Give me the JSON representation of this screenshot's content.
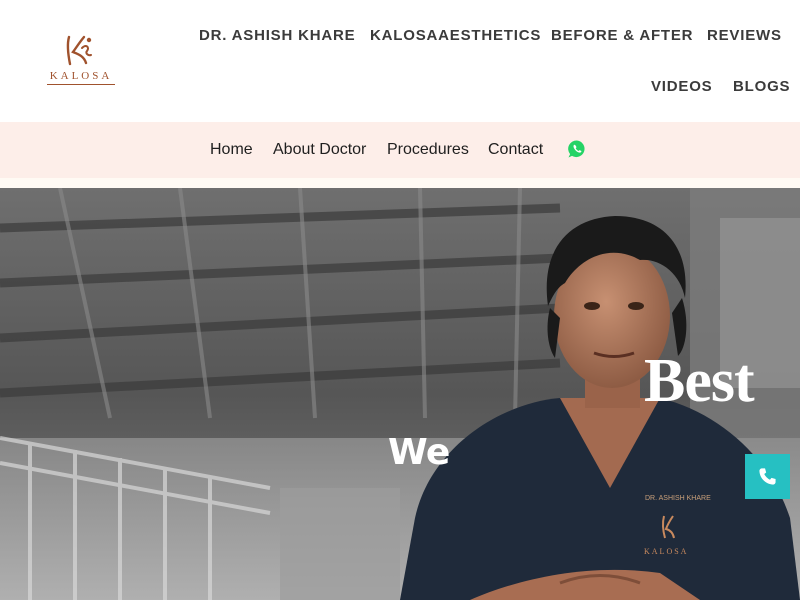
{
  "logo": {
    "text": "KALOSA",
    "icon": "kalosa-logo-icon"
  },
  "primary_nav": [
    {
      "label": "DR. ASHISH KHARE"
    },
    {
      "label": "KALOSAAESTHETICS"
    },
    {
      "label": "BEFORE & AFTER"
    },
    {
      "label": "REVIEWS"
    },
    {
      "label": "VIDEOS"
    },
    {
      "label": "BLOGS"
    }
  ],
  "secondary_nav": [
    {
      "label": "Home"
    },
    {
      "label": "About Doctor"
    },
    {
      "label": "Procedures"
    },
    {
      "label": "Contact"
    }
  ],
  "whatsapp": {
    "icon": "whatsapp-icon"
  },
  "hero": {
    "words": [
      "We",
      "Best"
    ],
    "embroidery": "DR. ASHISH KHARE",
    "embroidery_logo": "KALOSA"
  },
  "call_button": {
    "icon": "phone-icon"
  },
  "colors": {
    "brand": "#a0522d",
    "subnav_bg": "#fdeee9",
    "whatsapp": "#25d366",
    "call_button": "#26c0c2",
    "nav_text": "#3b3b3b"
  }
}
